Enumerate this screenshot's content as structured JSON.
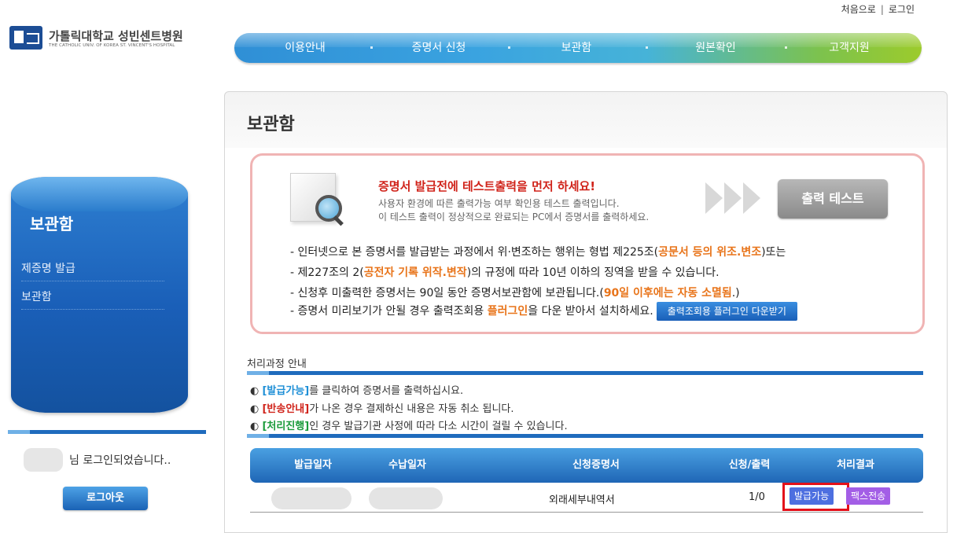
{
  "top_links": {
    "home": "처음으로",
    "separator": "|",
    "login": "로그인"
  },
  "logo": {
    "title": "가톨릭대학교 성빈센트병원",
    "subtitle": "THE CATHOLIC UNIV. OF KOREA ST. VINCENT'S HOSPITAL"
  },
  "nav": {
    "items": [
      "이용안내",
      "증명서 신청",
      "보관함",
      "원본확인",
      "고객지원"
    ]
  },
  "sidebar": {
    "title": "보관함",
    "items": [
      "제증명 발급",
      "보관함"
    ],
    "login_message": "님 로그인되었습니다..",
    "logout_label": "로그아웃"
  },
  "main": {
    "title": "보관함",
    "notice": {
      "warning_title": "증명서 발급전에 테스트출력을 먼저 하세요!",
      "line1": "사용자 환경에 따른 출력가능 여부 확인용 테스트 출력입니다.",
      "line2": "이 테스트 출력이 정상적으로 완료되는 PC에서 증명서를 출력하세요.",
      "print_test_label": "출력 테스트",
      "rule1_a": "- 인터넷으로 본 증명서를 발급받는 과정에서 위·변조하는 행위는 형법 제225조(",
      "rule1_b": "공문서 등의 위조.변조",
      "rule1_c": ")또는",
      "rule2_a": "- 제227조의 2(",
      "rule2_b": "공전자 기록 위작.변작",
      "rule2_c": ")의 규정에 따라 10년 이하의 징역을 받을 수 있습니다.",
      "rule3_a": "- 신청후 미출력한 증명서는 90일 동안 증명서보관함에 보관됩니다.(",
      "rule3_b": "90일 이후에는 자동 소멸됨",
      "rule3_c": ".)",
      "rule4_a": "- 증명서 미리보기가 안될 경우 출력조회용 ",
      "rule4_b": "플러그인",
      "rule4_c": "을 다운 받아서 설치하세요.",
      "plugin_button_label": "출력조회용 플러그인 다운받기"
    },
    "process": {
      "title": "처리과정 안내",
      "line1_tag": "[발급가능]",
      "line1_text": "를 클릭하여 증명서를 출력하십시요.",
      "line2_tag": "[반송안내]",
      "line2_text": "가 나온 경우 결제하신 내용은 자동 취소 됩니다.",
      "line3_tag": "[처리진행]",
      "line3_text": "인 경우 발급기관 사정에 따라 다소 시간이 걸릴 수 있습니다.",
      "bullet": "◐"
    },
    "table": {
      "columns": [
        "발급일자",
        "수납일자",
        "신청증명서",
        "신청/출력",
        "처리결과"
      ],
      "rows": [
        {
          "issue_date": "",
          "pay_date": "",
          "certificate": "외래세부내역서",
          "count": "1/0",
          "result_primary": "발급가능",
          "result_secondary": "팩스전송"
        }
      ]
    }
  },
  "colors": {
    "accent_blue": "#1f6bbd",
    "warning_red": "#d0231a",
    "highlight_orange": "#e8741a",
    "badge_blue": "#4d6fe0",
    "badge_purple": "#a35ee6"
  }
}
